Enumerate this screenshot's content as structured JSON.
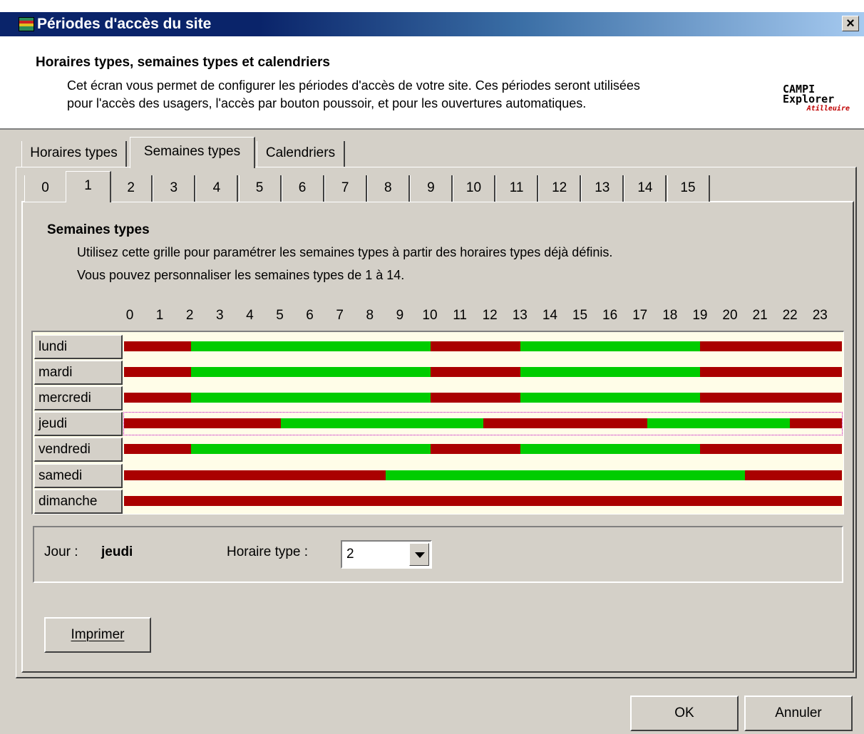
{
  "window": {
    "title": "Périodes d'accès du site",
    "close_label": "×"
  },
  "header": {
    "title": "Horaires types, semaines types et calendriers",
    "description_line1": "Cet écran vous permet de configurer les périodes d'accès de votre site. Ces périodes seront utilisées",
    "description_line2": "pour l'accès des usagers, l'accès par bouton poussoir, et pour les ouvertures automatiques.",
    "logo": {
      "line1": "CAMPI",
      "line2": "Explorer",
      "line3": "Atilleuire"
    }
  },
  "outer_tabs": [
    "Horaires types",
    "Semaines types",
    "Calendriers"
  ],
  "outer_selected": 1,
  "week_tabs": [
    "0",
    "1",
    "2",
    "3",
    "4",
    "5",
    "6",
    "7",
    "8",
    "9",
    "10",
    "11",
    "12",
    "13",
    "14",
    "15"
  ],
  "week_selected": 1,
  "section": {
    "title": "Semaines types",
    "line1": "Utilisez cette grille pour paramétrer les semaines types à partir des horaires types déjà définis.",
    "line2": "Vous pouvez personnaliser les semaines types de 1 à 14."
  },
  "hours": [
    "0",
    "1",
    "2",
    "3",
    "4",
    "5",
    "6",
    "7",
    "8",
    "9",
    "10",
    "11",
    "12",
    "13",
    "14",
    "15",
    "16",
    "17",
    "18",
    "19",
    "20",
    "21",
    "22",
    "23"
  ],
  "colors": {
    "open": "#00cc00",
    "closed": "#aa0000",
    "grid_bg": "#fffde8"
  },
  "days": [
    {
      "name": "lundi",
      "open": [
        [
          2.25,
          10.25
        ],
        [
          13.25,
          19.25
        ]
      ]
    },
    {
      "name": "mardi",
      "open": [
        [
          2.25,
          10.25
        ],
        [
          13.25,
          19.25
        ]
      ]
    },
    {
      "name": "mercredi",
      "open": [
        [
          2.25,
          10.25
        ],
        [
          13.25,
          19.25
        ]
      ]
    },
    {
      "name": "jeudi",
      "open": [
        [
          5.25,
          12
        ],
        [
          17.5,
          22.25
        ]
      ]
    },
    {
      "name": "vendredi",
      "open": [
        [
          2.25,
          10.25
        ],
        [
          13.25,
          19.25
        ]
      ]
    },
    {
      "name": "samedi",
      "open": [
        [
          8.75,
          20.75
        ]
      ]
    },
    {
      "name": "dimanche",
      "open": []
    }
  ],
  "selected_day_index": 3,
  "detail": {
    "jour_label": "Jour :",
    "jour_value": "jeudi",
    "horaire_label": "Horaire type :",
    "horaire_value": "2"
  },
  "buttons": {
    "print": "Imprimer",
    "ok": "OK",
    "cancel": "Annuler"
  }
}
